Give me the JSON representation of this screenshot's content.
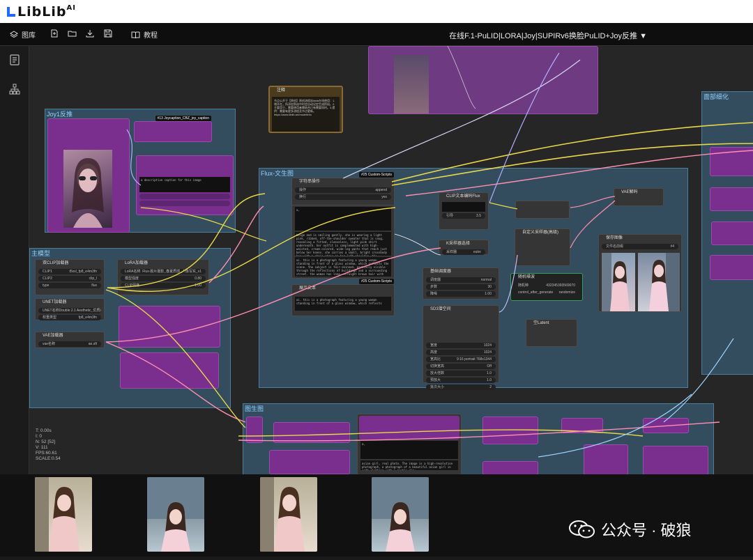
{
  "brand": {
    "name": "LibLib",
    "sup": "AI"
  },
  "menubar": {
    "library_label": "图库",
    "tutorial_label": "教程",
    "workflow_title": "在线F.1-PuLID|LORA|Joy|SUPIRv6换脸PuLID+Joy反推",
    "caret": "▼"
  },
  "groups": {
    "joy": "Joy1反推",
    "main": "主模型",
    "flux": "Flux-文生图",
    "tusheng": "图生图",
    "right": "面部细化"
  },
  "nodes": {
    "custom_scripts": "#25 Custom-Scripts",
    "custom_scripts2": "#25 Custom-Scripts",
    "string_node": "字符串操作",
    "clip_encode": "CLIP文本编码Flux",
    "vae_decode": "VAE解码",
    "k_sampler": "K采样器选择",
    "custom_sampler": "自定义采样器(高级)",
    "noise": "随机噪波",
    "noise_seed_label": "随机种",
    "noise_seed_value": "432345393569070",
    "noise_control_label": "control_after_generate",
    "noise_control_value": "randomize",
    "scheduler": "基础调度器",
    "sd3_latent": "SD3潜空间",
    "empty_latent": "空Latent",
    "save_image": "保存图像",
    "save_prefix_label": "文件名前缀",
    "save_prefix_value": "#4",
    "dual_clip": "双CLIP加载器",
    "lora_loader": "LoRA加载器",
    "unet_loader": "UNET加载器",
    "vae_loader": "VAE加载器",
    "show_text": "展示文本",
    "note_title": "注释",
    "joy_caption": "#13 Joycaption_CBZ_joy_caption"
  },
  "rows": {
    "clip1": [
      "CLIP1",
      "t5xxl_fp8_e4m3fn"
    ],
    "clip2": [
      "CLIP2",
      "clip_l"
    ],
    "type": [
      "type",
      "flux"
    ],
    "lora_name": [
      "LoRA名称",
      "Flux-胶片摄影_春夏质感_人像写实_v1"
    ],
    "lora_model": [
      "模型强度",
      "0.80"
    ],
    "lora_clip": [
      "CLIP强度",
      "1.00"
    ],
    "unet_name": [
      "UNET名称",
      "Double 2.1 Aesthetic_优质版"
    ],
    "unet_dtype": [
      "权重类型",
      "fp8_e4m3fn"
    ],
    "vae_name": [
      "vae名称",
      "ae.sft"
    ],
    "sampler_name": [
      "采样器",
      "euler"
    ],
    "sched1": [
      "调度器",
      "normal"
    ],
    "sched2": [
      "步数",
      "30"
    ],
    "sched3": [
      "降噪",
      "1.00"
    ],
    "sd3_w": [
      "宽度",
      "1024"
    ],
    "sd3_h": [
      "高度",
      "1024"
    ],
    "sd3_ratio": [
      "宽高比",
      "9:16 portrait 768x1344"
    ],
    "sd3_swap": [
      "切换宽高",
      "Off"
    ],
    "sd3_up": [
      "放大倍数",
      "1.0"
    ],
    "sd3_pre": [
      "预放大",
      "1.0"
    ],
    "sd3_batch": [
      "批次大小",
      "2"
    ],
    "str_op1": [
      "操作",
      "append"
    ],
    "str_op2": [
      "换行",
      "yes"
    ],
    "guidance": [
      "引导",
      "3.5"
    ]
  },
  "texts": {
    "joy_prompt": "a descriptive caption for this image",
    "prompt_main": "beige and is smiling gently. she is wearing a light pink, ribbed, off-the-shoulder sweater that is snug, revealing a fitted, sleeveless, light pink shirt underneath. her outfit is complemented with high-waisted, cream-colored, wide-leg pants that reach just below her knees. she carries a small, bright crossbody bag with a chain strap on her left shoulder. the woman's skin is fair, and she has a slender physique with a modest breast size. the background shows a cityscape with modern buildings.",
    "prompt_2": "ai. this is a photograph featuring a young woman standing in front of a glass window, which reflects the scene. the subject is fair-skinned, partially visible through the reflections of buildings and a surrounding street. the woman has long, straight brown hair with bangs.",
    "show_text_body": "ai. this is a photograph featuring a young woman standing in front of a glass window, which reflects",
    "tusheng_prompt": "asian girl, real photo. The image is a high-resolution photograph, a photograph of a beautiful asian girl in soft clothing with a gentle glow.",
    "note_body": "节点公开于【原创】原创流程站liblib在线使用：1.增开在，所添加到选中时会自动设定生成阶段。2.主要用于，需要使用者需结合已有需要同时。3.提供：需要有更多流程及节点更新。https://www.liblib.art/modelinfo"
  },
  "stats": {
    "t": "T: 0.00s",
    "i": "I: 0",
    "n": "N: 52 [52]",
    "v": "V: 111",
    "fps": "FPS:60.61",
    "scale": "SCALE:0.54"
  },
  "watermark": "公众号 · 破狼",
  "colors": {
    "accent": "#1d6bff",
    "node": "#7a2f8e",
    "group": "#406e8c"
  }
}
